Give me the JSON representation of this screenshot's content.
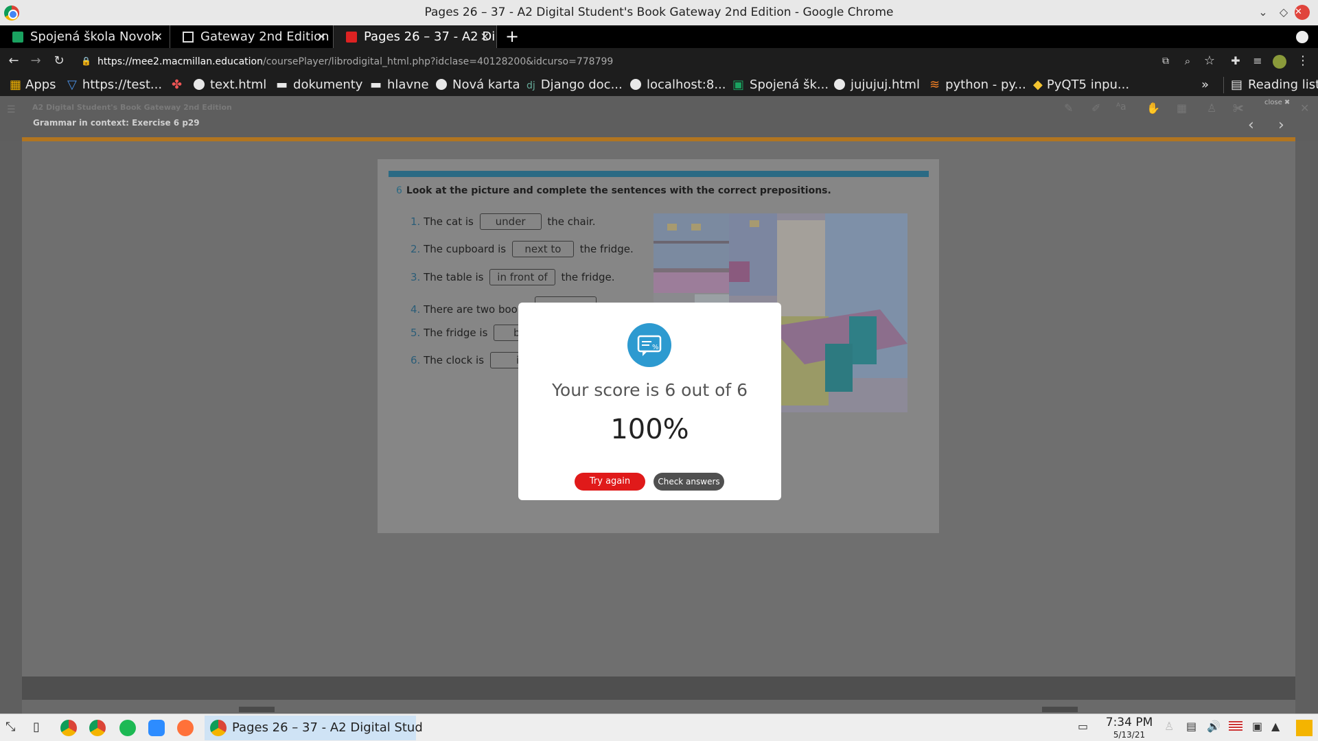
{
  "window": {
    "title": "Pages 26 – 37 - A2 Digital Student's Book Gateway 2nd Edition - Google Chrome"
  },
  "tabs": [
    {
      "label": "Spojená škola Novoh"
    },
    {
      "label": "Gateway 2nd Edition"
    },
    {
      "label": "Pages 26 – 37 - A2 Di"
    }
  ],
  "address": {
    "host": "https://mee2.macmillan.education",
    "path": "/coursePlayer/librodigital_html.php?idclase=40128200&idcurso=778799"
  },
  "bookmarks": [
    "Apps",
    "https://test...",
    "text.html",
    "dokumenty",
    "hlavne",
    "Nová karta",
    "Django doc...",
    "localhost:8...",
    "Spojená šk...",
    "jujujuj.html",
    "python - py...",
    "PyQT5 inpu..."
  ],
  "reading_list": "Reading list",
  "more_bookmarks": "»",
  "app": {
    "book_title": "A2 Digital Student's Book Gateway 2nd Edition",
    "exercise_title": "Grammar in context: Exercise 6 p29",
    "close_label": "close ✖"
  },
  "exercise": {
    "number": "6",
    "instruction": "Look at the picture and complete the sentences with the correct prepositions.",
    "items": [
      {
        "num": "1.",
        "before": "The cat is",
        "answer": "under",
        "after": "the chair."
      },
      {
        "num": "2.",
        "before": "The cupboard is",
        "answer": "next to",
        "after": "the fridge."
      },
      {
        "num": "3.",
        "before": "The table is",
        "answer": "in front of",
        "after": "the fridge."
      },
      {
        "num": "4.",
        "before": "There are two books",
        "answer": "",
        "after": ""
      },
      {
        "num": "5.",
        "before": "The fridge is",
        "answer": "behi",
        "after": ""
      },
      {
        "num": "6.",
        "before": "The clock is",
        "answer": "in",
        "after": ""
      }
    ]
  },
  "modal": {
    "score_text": "Your score is 6 out of 6",
    "percent": "100%",
    "try_again": "Try again",
    "check_answers": "Check answers"
  },
  "taskbar": {
    "app_label": "Pages 26 – 37 - A2 Digital Stud",
    "time": "7:34 PM",
    "date": "5/13/21"
  },
  "colors": {
    "accent_orange": "#b17520",
    "header_blue": "#2b6a84",
    "try_red": "#e01a1a",
    "icon_blue": "#2d9ad0"
  }
}
